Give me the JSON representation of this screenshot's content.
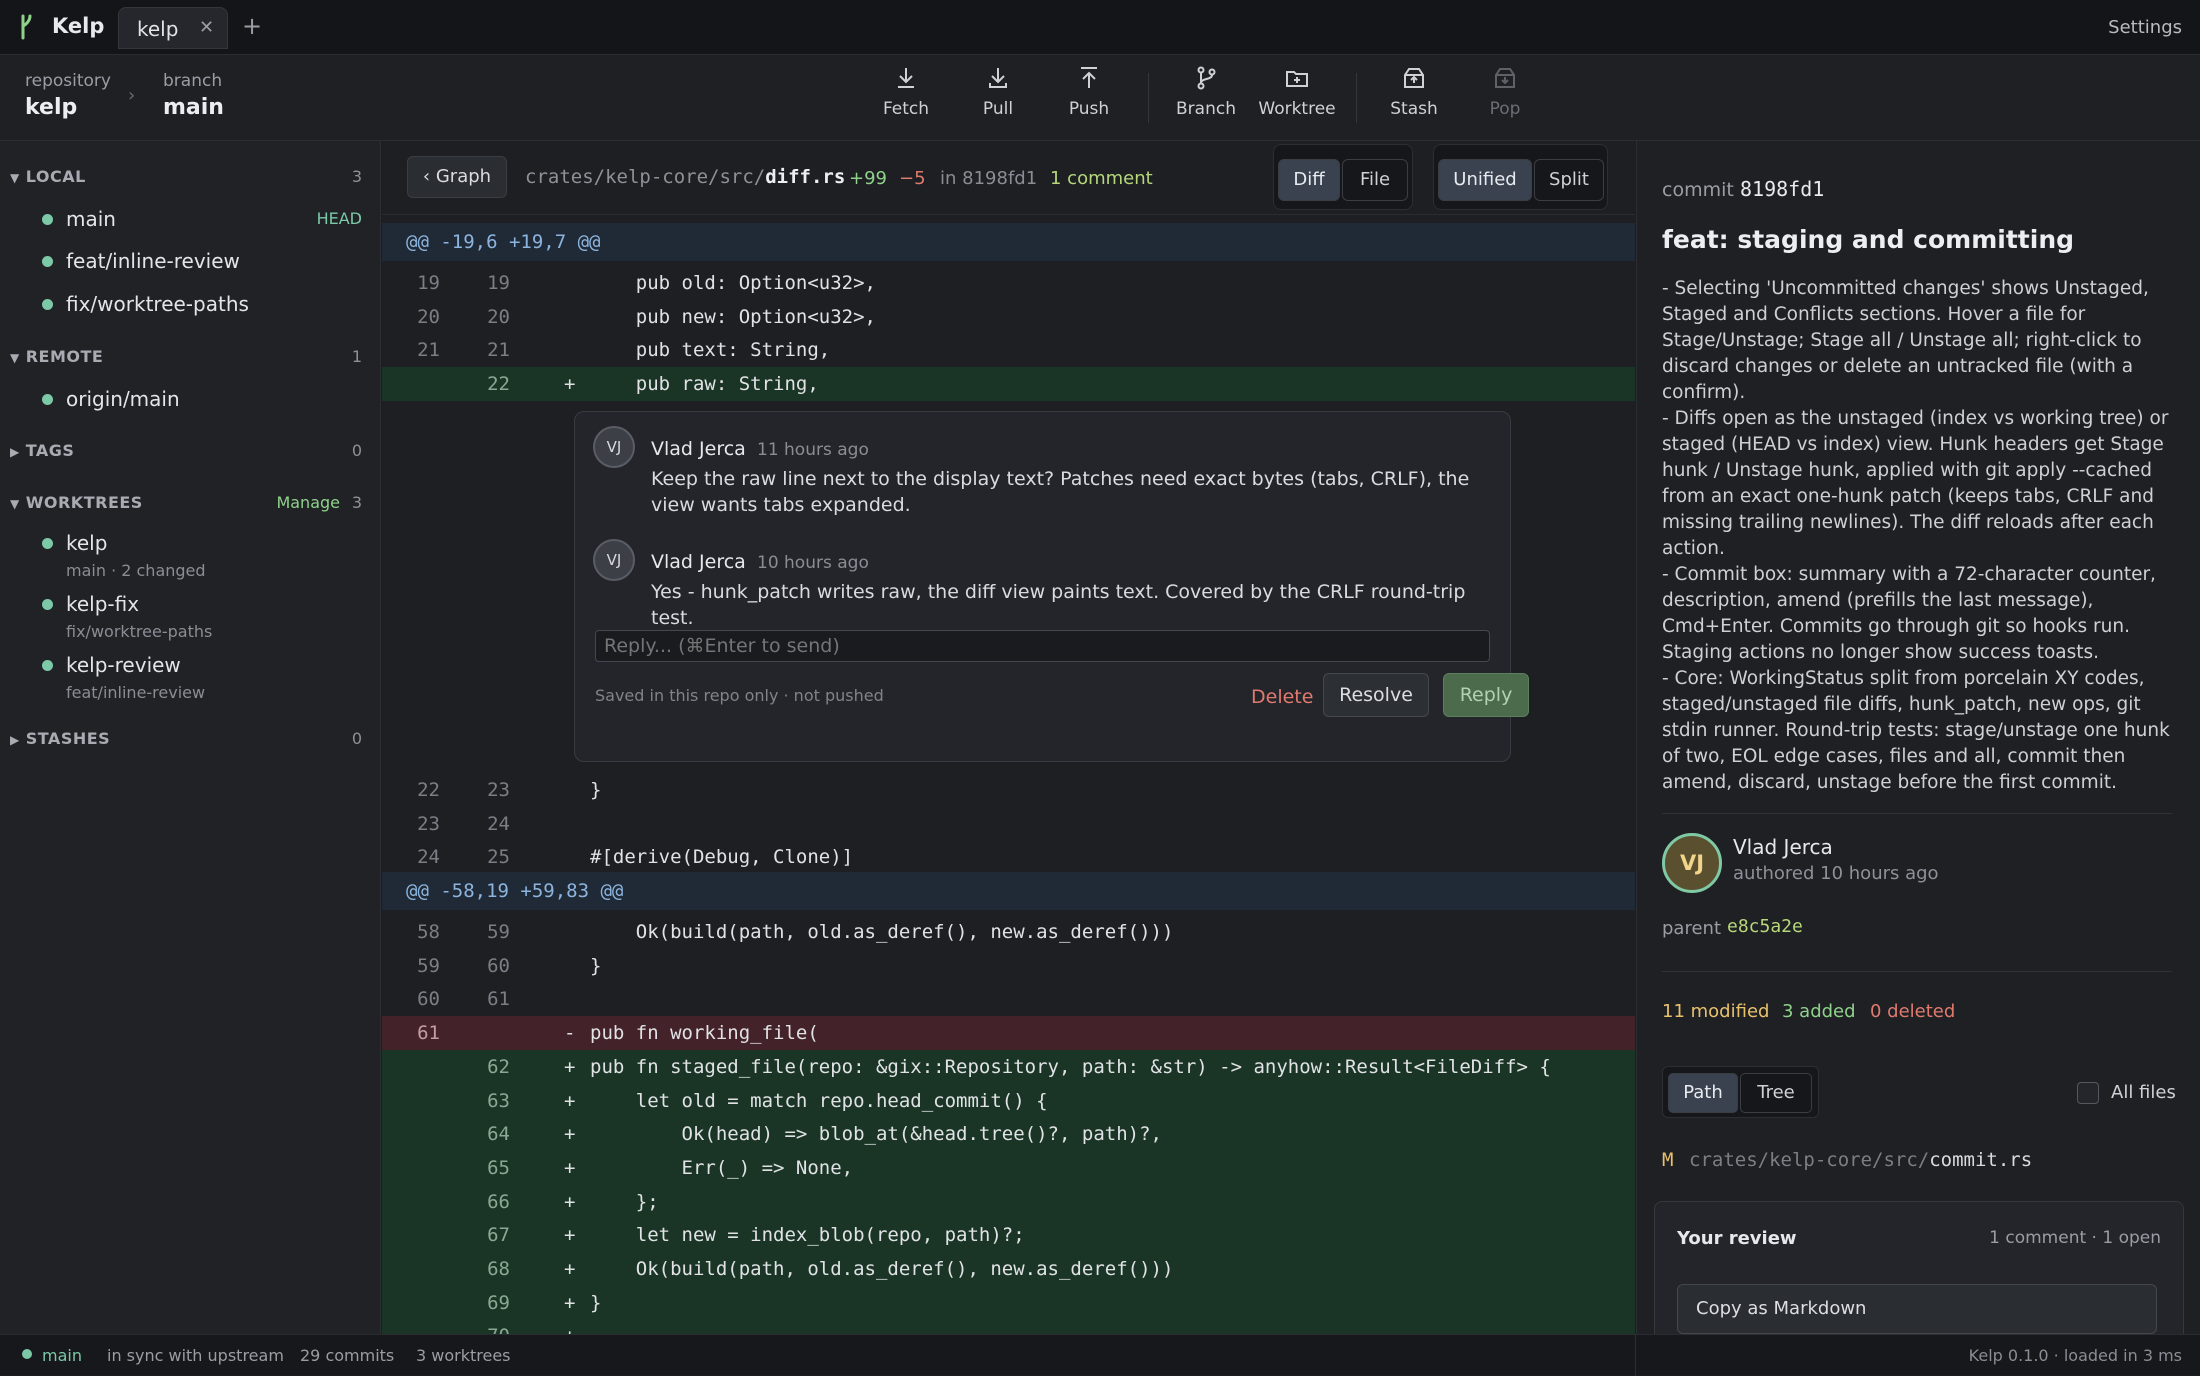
{
  "app": {
    "name": "Kelp",
    "tab": "kelp",
    "settings": "Settings"
  },
  "header": {
    "repo_label": "repository",
    "repo": "kelp",
    "branch_label": "branch",
    "branch": "main",
    "toolbar": {
      "fetch": "Fetch",
      "pull": "Pull",
      "push": "Push",
      "branch": "Branch",
      "worktree": "Worktree",
      "stash": "Stash",
      "pop": "Pop"
    }
  },
  "sidebar": {
    "local": {
      "title": "LOCAL",
      "count": "3",
      "items": [
        {
          "name": "main",
          "badge": "HEAD"
        },
        {
          "name": "feat/inline-review"
        },
        {
          "name": "fix/worktree-paths"
        }
      ]
    },
    "remote": {
      "title": "REMOTE",
      "count": "1",
      "items": [
        {
          "name": "origin/main"
        }
      ]
    },
    "tags": {
      "title": "TAGS",
      "count": "0"
    },
    "worktrees": {
      "title": "WORKTREES",
      "manage": "Manage",
      "count": "3",
      "items": [
        {
          "name": "kelp",
          "sub": "main · 2 changed"
        },
        {
          "name": "kelp-fix",
          "sub": "fix/worktree-paths"
        },
        {
          "name": "kelp-review",
          "sub": "feat/inline-review"
        }
      ]
    },
    "stashes": {
      "title": "STASHES",
      "count": "0"
    }
  },
  "filebar": {
    "graph": "‹ Graph",
    "path_dir": "crates/kelp-core/src/",
    "path_file": "diff.rs",
    "added": "+99",
    "deleted": "−5",
    "in_commit": "in 8198fd1",
    "comments": "1 comment",
    "view_diff": "Diff",
    "view_file": "File",
    "mode_unified": "Unified",
    "mode_split": "Split"
  },
  "diff": {
    "hunk1": "@@ -19,6 +19,7 @@",
    "lines1": [
      {
        "o": "19",
        "n": "19",
        "s": "",
        "c": "    pub old: Option<u32>,",
        "t": "ctx"
      },
      {
        "o": "20",
        "n": "20",
        "s": "",
        "c": "    pub new: Option<u32>,",
        "t": "ctx"
      },
      {
        "o": "21",
        "n": "21",
        "s": "",
        "c": "    pub text: String,",
        "t": "ctx"
      },
      {
        "o": "",
        "n": "22",
        "s": "+",
        "c": "    pub raw: String,",
        "t": "add"
      }
    ],
    "lines2": [
      {
        "o": "22",
        "n": "23",
        "s": "",
        "c": "}",
        "t": "ctx"
      },
      {
        "o": "23",
        "n": "24",
        "s": "",
        "c": "",
        "t": "ctx"
      },
      {
        "o": "24",
        "n": "25",
        "s": "",
        "c": "#[derive(Debug, Clone)]",
        "t": "ctx"
      }
    ],
    "hunk2": "@@ -58,19 +59,83 @@",
    "lines3": [
      {
        "o": "58",
        "n": "59",
        "s": "",
        "c": "    Ok(build(path, old.as_deref(), new.as_deref()))",
        "t": "ctx"
      },
      {
        "o": "59",
        "n": "60",
        "s": "",
        "c": "}",
        "t": "ctx"
      },
      {
        "o": "60",
        "n": "61",
        "s": "",
        "c": "",
        "t": "ctx"
      },
      {
        "o": "61",
        "n": "",
        "s": "-",
        "c": "pub fn working_file(",
        "t": "del"
      },
      {
        "o": "",
        "n": "62",
        "s": "+",
        "c": "pub fn staged_file(repo: &gix::Repository, path: &str) -> anyhow::Result<FileDiff> {",
        "t": "add"
      },
      {
        "o": "",
        "n": "63",
        "s": "+",
        "c": "    let old = match repo.head_commit() {",
        "t": "add"
      },
      {
        "o": "",
        "n": "64",
        "s": "+",
        "c": "        Ok(head) => blob_at(&head.tree()?, path)?,",
        "t": "add"
      },
      {
        "o": "",
        "n": "65",
        "s": "+",
        "c": "        Err(_) => None,",
        "t": "add"
      },
      {
        "o": "",
        "n": "66",
        "s": "+",
        "c": "    };",
        "t": "add"
      },
      {
        "o": "",
        "n": "67",
        "s": "+",
        "c": "    let new = index_blob(repo, path)?;",
        "t": "add"
      },
      {
        "o": "",
        "n": "68",
        "s": "+",
        "c": "    Ok(build(path, old.as_deref(), new.as_deref()))",
        "t": "add"
      },
      {
        "o": "",
        "n": "69",
        "s": "+",
        "c": "}",
        "t": "add"
      },
      {
        "o": "",
        "n": "70",
        "s": "+",
        "c": "",
        "t": "add"
      }
    ]
  },
  "thread": {
    "comments": [
      {
        "initials": "VJ",
        "author": "Vlad Jerca",
        "time": "11 hours ago",
        "text": "Keep the raw line next to the display text? Patches need exact bytes (tabs, CRLF), the view wants tabs expanded."
      },
      {
        "initials": "VJ",
        "author": "Vlad Jerca",
        "time": "10 hours ago",
        "text": "Yes - hunk_patch writes raw, the diff view paints text. Covered by the CRLF round-trip test."
      }
    ],
    "reply_placeholder": "Reply... (⌘Enter to send)",
    "saved_note": "Saved in this repo only · not pushed",
    "delete": "Delete",
    "resolve": "Resolve",
    "reply": "Reply"
  },
  "commit": {
    "label": "commit",
    "hash": "8198fd1",
    "title": "feat: staging and committing",
    "body": [
      "- Selecting 'Uncommitted changes' shows Unstaged, Staged and Conflicts sections. Hover a file for Stage/Unstage; Stage all / Unstage all; right-click to discard changes or delete an untracked file (with a confirm).",
      "- Diffs open as the unstaged (index vs working tree) or staged (HEAD vs index) view. Hunk headers get Stage hunk / Unstage hunk, applied with git apply --cached from an exact one-hunk patch (keeps tabs, CRLF and missing trailing newlines). The diff reloads after each action.",
      "- Commit box: summary with a 72-character counter, description, amend (prefills the last message), Cmd+Enter. Commits go through git so hooks run. Staging actions no longer show success toasts.",
      "- Core: WorkingStatus split from porcelain XY codes, staged/unstaged file diffs, hunk_patch, new ops, git stdin runner. Round-trip tests: stage/unstage one hunk of two, EOL edge cases, files and all, commit then amend, discard, unstage before the first commit."
    ],
    "author_initials": "VJ",
    "author": "Vlad Jerca",
    "authored": "authored 10 hours ago",
    "parent_label": "parent",
    "parent": "e8c5a2e",
    "modified": "11 modified",
    "added": "3 added",
    "deleted": "0 deleted",
    "view_path": "Path",
    "view_tree": "Tree",
    "all_files": "All files",
    "file_status": "M",
    "file_dir": "crates/kelp-core/src/",
    "file_name": "commit.rs"
  },
  "review": {
    "title": "Your review",
    "count": "1 comment · 1 open",
    "copy": "Copy as Markdown"
  },
  "statusbar": {
    "branch": "main",
    "sync": "in sync with upstream",
    "commits": "29 commits",
    "worktrees": "3 worktrees",
    "version": "Kelp 0.1.0",
    "loaded": "loaded in 3 ms"
  },
  "colors": {
    "accent_green": "#7cc9a8",
    "add_bg": "#1a3526",
    "del_bg": "#44222a",
    "added_text": "#8fd28a",
    "deleted_text": "#e07a6e",
    "modified_text": "#e9c16b"
  }
}
